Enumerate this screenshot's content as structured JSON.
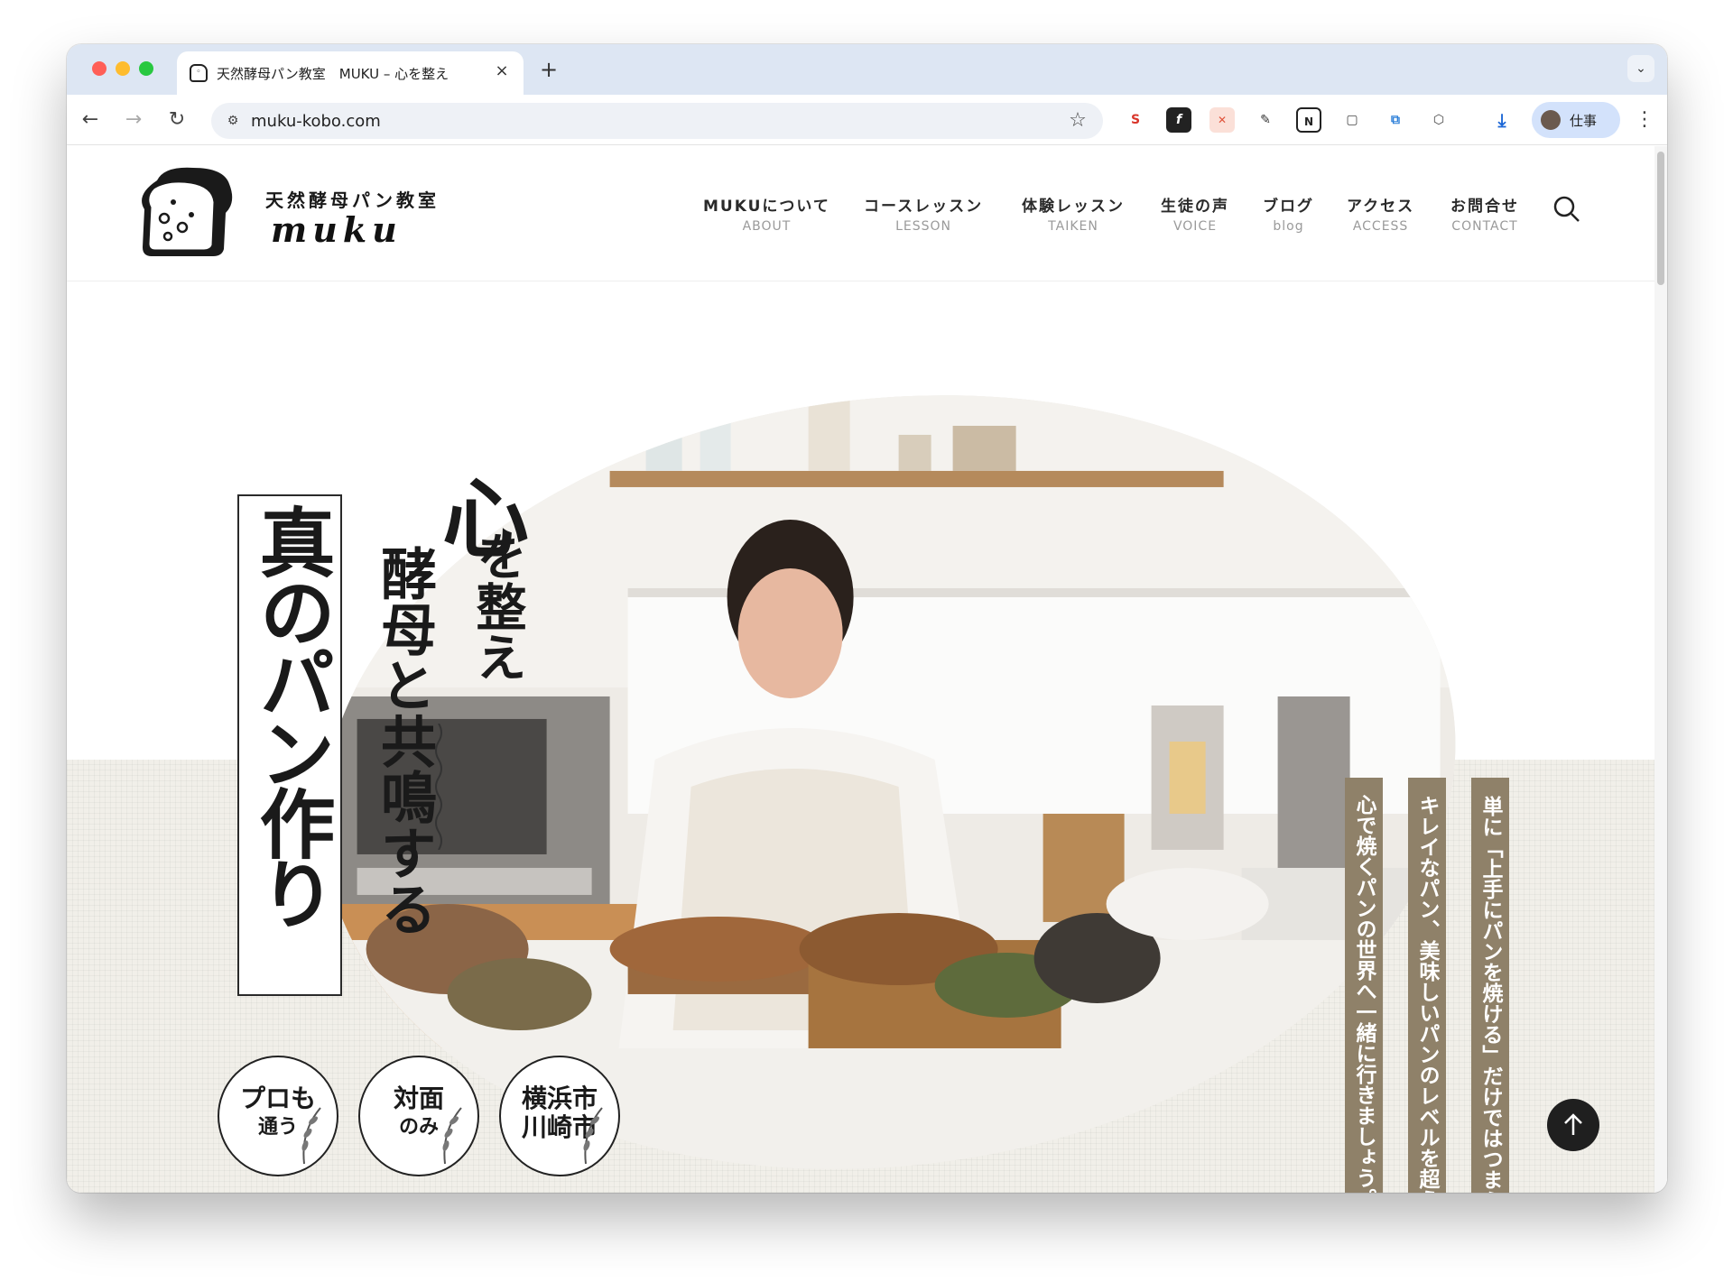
{
  "browser": {
    "tab_title": "天然酵母パン教室　MUKU – 心を整え",
    "tab_close_glyph": "×",
    "new_tab_glyph": "+",
    "url": "muku-kobo.com",
    "profile_label": "仕事"
  },
  "site": {
    "logo_title": "天然酵母パン教室",
    "logo_word": "muku",
    "nav": [
      {
        "jp": "MUKUについて",
        "en": "ABOUT"
      },
      {
        "jp": "コースレッスン",
        "en": "LESSON"
      },
      {
        "jp": "体験レッスン",
        "en": "TAIKEN"
      },
      {
        "jp": "生徒の声",
        "en": "VOICE"
      },
      {
        "jp": "ブログ",
        "en": "blog"
      },
      {
        "jp": "アクセス",
        "en": "ACCESS"
      },
      {
        "jp": "お問合せ",
        "en": "CONTACT"
      }
    ]
  },
  "hero": {
    "main_copy": "真のパン作り",
    "kokoro": "心",
    "copy_line1": "を整え",
    "copy_line2": "酵母と共鳴する",
    "tags": [
      "心で焼くパンの世界へ一緒に行きましょう。",
      "キレイなパン、美味しいパンのレベルを超えた、",
      "単に「上手にパンを焼ける」だけではつまらない。"
    ],
    "badges": [
      {
        "line1": "プロも",
        "line2": "通う"
      },
      {
        "line1": "対面",
        "line2": "のみ"
      },
      {
        "line1": "横浜市",
        "line2": "川崎市"
      }
    ]
  },
  "colors": {
    "tab_strip": "#dde6f3",
    "tag_bg": "#8f8169",
    "hero_lower_bg": "#f1efe9",
    "to_top_bg": "#1f1f1f"
  }
}
